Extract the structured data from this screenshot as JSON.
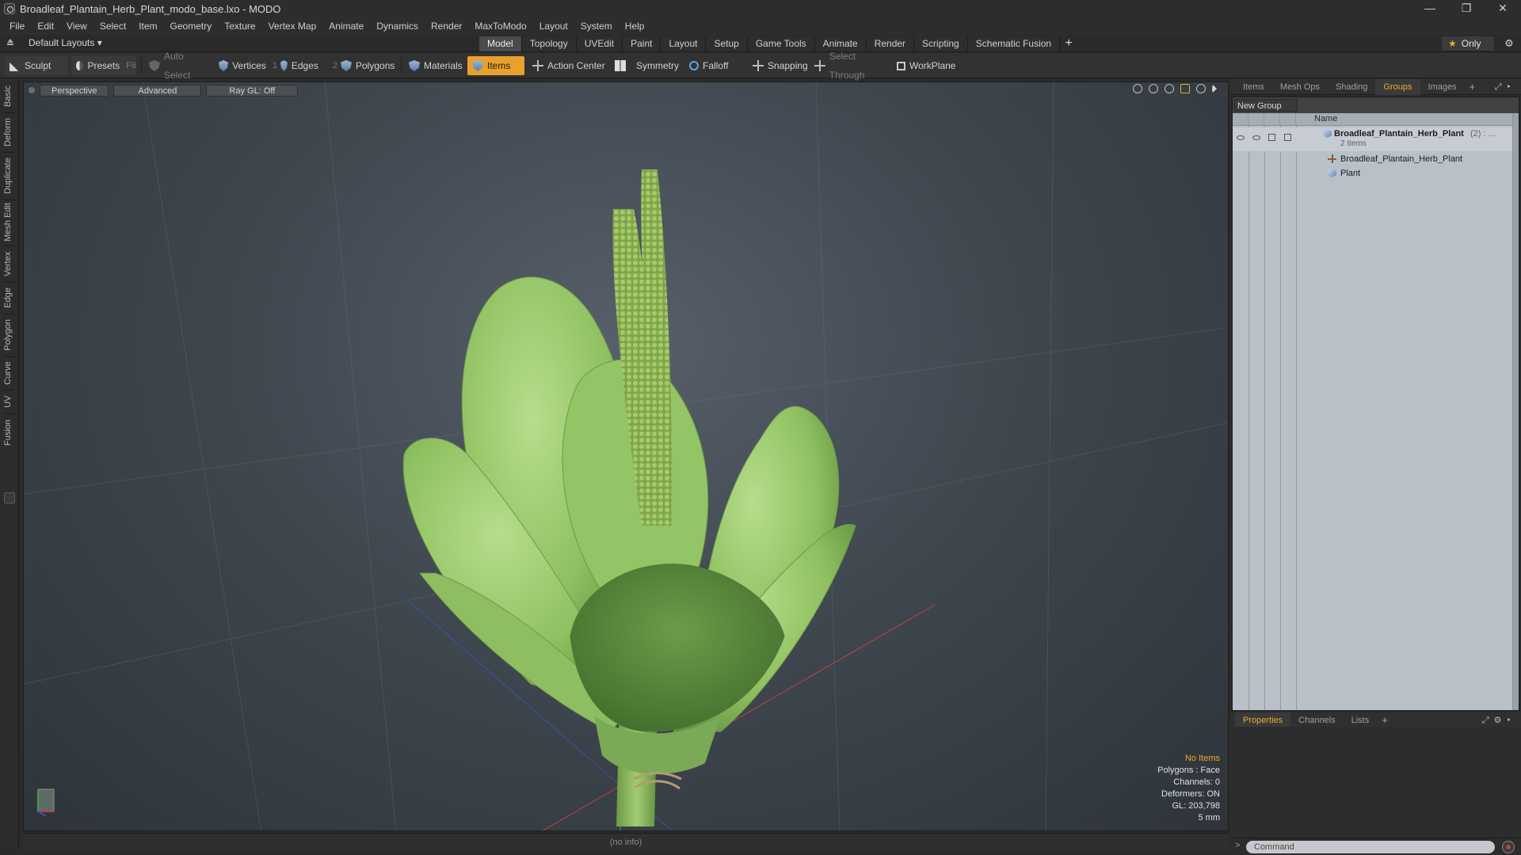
{
  "window": {
    "title": "Broadleaf_Plantain_Herb_Plant_modo_base.lxo - MODO",
    "controls": [
      "—",
      "❐",
      "✕"
    ]
  },
  "menu": [
    "File",
    "Edit",
    "View",
    "Select",
    "Item",
    "Geometry",
    "Texture",
    "Vertex Map",
    "Animate",
    "Dynamics",
    "Render",
    "MaxToModo",
    "Layout",
    "System",
    "Help"
  ],
  "layout_bar": {
    "layout_selector": "Default Layouts ▾",
    "tabs": [
      "Model",
      "Topology",
      "UVEdit",
      "Paint",
      "Layout",
      "Setup",
      "Game Tools",
      "Animate",
      "Render",
      "Scripting",
      "Schematic Fusion"
    ],
    "active_tab": "Model",
    "add": "+",
    "only_label": "Only",
    "star": "★",
    "gear": "⚙"
  },
  "toolbar": {
    "sculpt": "Sculpt",
    "presets": "Presets",
    "presets_key": "F6",
    "auto_select": "Auto Select",
    "vertices": "Vertices",
    "vertices_num": "1",
    "edges": "Edges",
    "edges_num": "2",
    "polygons": "Polygons",
    "materials": "Materials",
    "items": "Items",
    "action_center": "Action Center",
    "symmetry": "Symmetry",
    "falloff": "Falloff",
    "snapping": "Snapping",
    "select_through": "Select Through",
    "workplane": "WorkPlane"
  },
  "left_tabs": [
    "Basic",
    "Deform",
    "Duplicate",
    "Mesh Edit",
    "Vertex",
    "Edge",
    "Polygon",
    "Curve",
    "UV",
    "Fusion"
  ],
  "viewport": {
    "view_mode": "Perspective",
    "shading": "Advanced",
    "raygl": "Ray GL: Off",
    "stats": {
      "selection": "No Items",
      "polygons": "Polygons : Face",
      "channels": "Channels: 0",
      "deformers": "Deformers: ON",
      "gl": "GL: 203,798",
      "unit": "5 mm"
    },
    "status": "(no info)"
  },
  "right_panel": {
    "top_tabs": [
      "Items",
      "Mesh Ops",
      "Shading",
      "Groups",
      "Images"
    ],
    "active_top_tab": "Groups",
    "add": "+",
    "new_group": "New Group",
    "column_name": "Name",
    "group": {
      "name": "Broadleaf_Plantain_Herb_Plant",
      "count": "(2) : ...",
      "sub": "2 Items",
      "children": [
        {
          "name": "Broadleaf_Plantain_Herb_Plant",
          "icon": "locator-icon"
        },
        {
          "name": "Plant",
          "icon": "mesh-icon"
        }
      ]
    },
    "bottom_tabs": [
      "Properties",
      "Channels",
      "Lists"
    ],
    "active_bottom_tab": "Properties",
    "command_prompt": ">",
    "command_placeholder": "Command"
  },
  "colors": {
    "accent": "#f0a830",
    "items_active": "#e9a02c",
    "leaf_light": "#a8d27a",
    "leaf_dark": "#5f8f3f"
  }
}
